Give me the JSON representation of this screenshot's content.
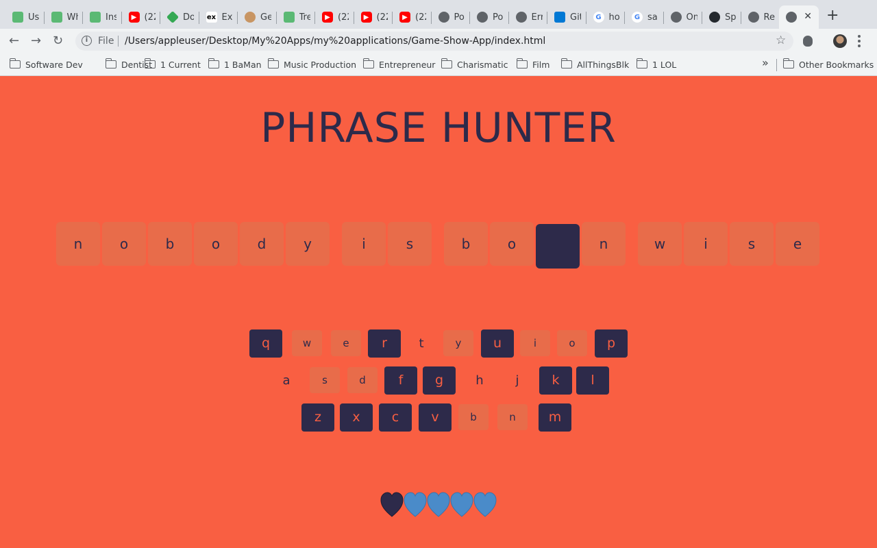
{
  "browser": {
    "tabs": [
      {
        "title": "Us",
        "favicon": "green-hexagon-icon"
      },
      {
        "title": "Wh",
        "favicon": "green-hexagon-icon"
      },
      {
        "title": "Ins",
        "favicon": "green-hexagon-icon"
      },
      {
        "title": "(22",
        "favicon": "youtube-icon"
      },
      {
        "title": "Do",
        "favicon": "green-cube-icon"
      },
      {
        "title": "Exp",
        "favicon": "ex-icon"
      },
      {
        "title": "Ge",
        "favicon": "pug-icon"
      },
      {
        "title": "Tre",
        "favicon": "green-hexagon-icon"
      },
      {
        "title": "(22",
        "favicon": "youtube-icon"
      },
      {
        "title": "(22",
        "favicon": "youtube-icon"
      },
      {
        "title": "(22",
        "favicon": "youtube-icon"
      },
      {
        "title": "Po",
        "favicon": "globe-icon"
      },
      {
        "title": "Po",
        "favicon": "globe-icon"
      },
      {
        "title": "Err",
        "favicon": "globe-icon"
      },
      {
        "title": "Git",
        "favicon": "vscode-icon"
      },
      {
        "title": "ho",
        "favicon": "google-icon"
      },
      {
        "title": "sa",
        "favicon": "google-icon"
      },
      {
        "title": "On",
        "favicon": "globe-icon"
      },
      {
        "title": "Sp",
        "favicon": "github-icon"
      },
      {
        "title": "Re",
        "favicon": "globe-icon"
      },
      {
        "title": "",
        "favicon": "globe-icon",
        "active": true
      }
    ],
    "address": {
      "scheme": "File",
      "url": "/Users/appleuser/Desktop/My%20Apps/my%20applications/Game-Show-App/index.html"
    },
    "bookmarks": [
      "Software Dev",
      "Dentist",
      "1 Current",
      "1 BaMan",
      "Music Production",
      "Entrepreneur",
      "Charismatic",
      "Film",
      "AllThingsBlk",
      "1 LOL"
    ],
    "other_bookmarks": "Other Bookmarks",
    "more": "»"
  },
  "game": {
    "title": "PHRASE HUNTER",
    "phrase": [
      {
        "letter": "n",
        "shown": false
      },
      {
        "letter": "o",
        "shown": false
      },
      {
        "letter": "b",
        "shown": false
      },
      {
        "letter": "o",
        "shown": false
      },
      {
        "letter": "d",
        "shown": false
      },
      {
        "letter": "y",
        "shown": false
      },
      {
        "letter": "i",
        "shown": false
      },
      {
        "letter": "s",
        "shown": false
      },
      {
        "letter": "b",
        "shown": false
      },
      {
        "letter": "o",
        "shown": false
      },
      {
        "letter": "",
        "shown": true
      },
      {
        "letter": "n",
        "shown": false
      },
      {
        "letter": "w",
        "shown": false
      },
      {
        "letter": "i",
        "shown": false
      },
      {
        "letter": "s",
        "shown": false
      },
      {
        "letter": "e",
        "shown": false
      }
    ],
    "keyboard": [
      [
        {
          "key": "q",
          "state": "chosen"
        },
        {
          "key": "w",
          "state": "wrong"
        },
        {
          "key": "e",
          "state": "wrong"
        },
        {
          "key": "r",
          "state": "chosen"
        },
        {
          "key": "t",
          "state": "plain"
        },
        {
          "key": "y",
          "state": "wrong"
        },
        {
          "key": "u",
          "state": "chosen"
        },
        {
          "key": "i",
          "state": "wrong"
        },
        {
          "key": "o",
          "state": "wrong"
        },
        {
          "key": "p",
          "state": "chosen"
        }
      ],
      [
        {
          "key": "a",
          "state": "plain"
        },
        {
          "key": "s",
          "state": "wrong"
        },
        {
          "key": "d",
          "state": "wrong"
        },
        {
          "key": "f",
          "state": "chosen"
        },
        {
          "key": "g",
          "state": "chosen"
        },
        {
          "key": "h",
          "state": "plain"
        },
        {
          "key": "j",
          "state": "plain"
        },
        {
          "key": "k",
          "state": "chosen"
        },
        {
          "key": "l",
          "state": "chosen"
        }
      ],
      [
        {
          "key": "z",
          "state": "chosen"
        },
        {
          "key": "x",
          "state": "chosen"
        },
        {
          "key": "c",
          "state": "chosen"
        },
        {
          "key": "v",
          "state": "chosen"
        },
        {
          "key": "b",
          "state": "wrong"
        },
        {
          "key": "n",
          "state": "wrong"
        },
        {
          "key": "m",
          "state": "chosen"
        }
      ]
    ],
    "lives": {
      "lost": 1,
      "remaining": 4,
      "lost_color": "#2d2a4a",
      "live_color": "#4a8bc9"
    }
  },
  "colors": {
    "background": "#f95f42",
    "dark": "#2d2a4a",
    "tile": "#e86c4a"
  }
}
